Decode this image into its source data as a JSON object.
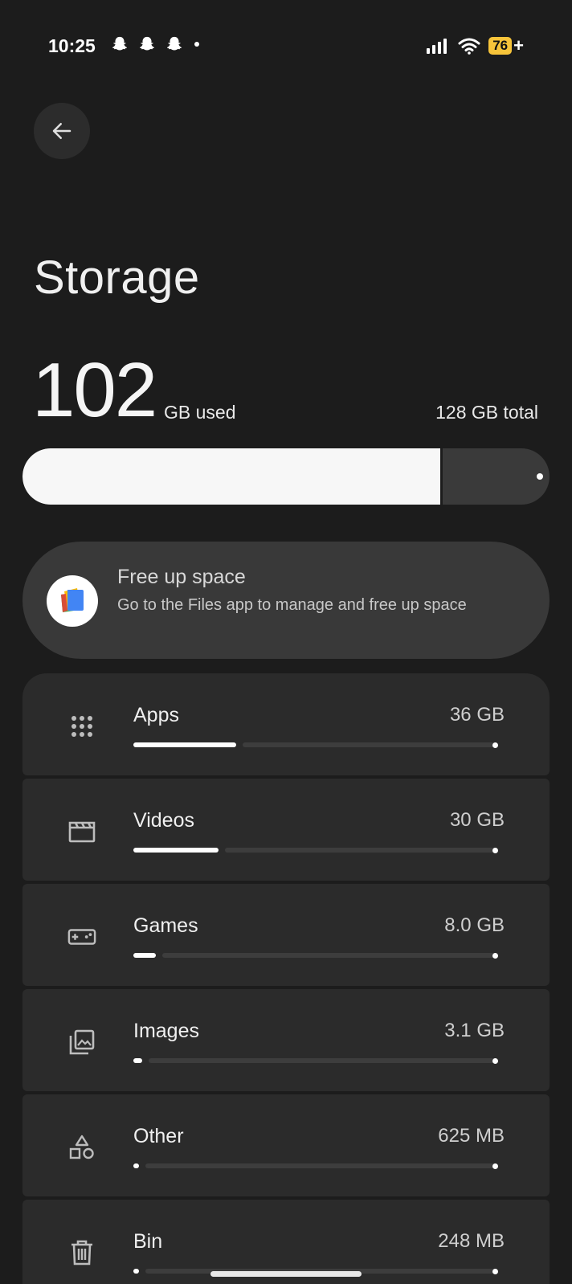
{
  "status_bar": {
    "time": "10:25",
    "battery": "76",
    "battery_charging": "+",
    "notifications": [
      "snapchat-icon",
      "snapchat-icon",
      "snapchat-icon",
      "dot-icon"
    ]
  },
  "page": {
    "title": "Storage"
  },
  "usage": {
    "used_number": "102",
    "used_unit": "GB used",
    "total": "128 GB total",
    "used_fraction": 0.797
  },
  "free_up": {
    "title": "Free up space",
    "subtitle": "Go to the Files app to manage and free up space"
  },
  "categories": [
    {
      "name": "Apps",
      "size": "36 GB",
      "icon": "apps-grid-icon",
      "fraction": 0.281
    },
    {
      "name": "Videos",
      "size": "30 GB",
      "icon": "clapperboard-icon",
      "fraction": 0.234
    },
    {
      "name": "Games",
      "size": "8.0 GB",
      "icon": "gamepad-icon",
      "fraction": 0.0625
    },
    {
      "name": "Images",
      "size": "3.1 GB",
      "icon": "images-icon",
      "fraction": 0.024
    },
    {
      "name": "Other",
      "size": "625 MB",
      "icon": "shapes-icon",
      "fraction": 0.005
    },
    {
      "name": "Bin",
      "size": "248 MB",
      "icon": "trash-icon",
      "fraction": 0.002
    }
  ],
  "colors": {
    "background": "#1c1c1c",
    "card": "#2b2b2b",
    "battery": "#f7c43a"
  }
}
